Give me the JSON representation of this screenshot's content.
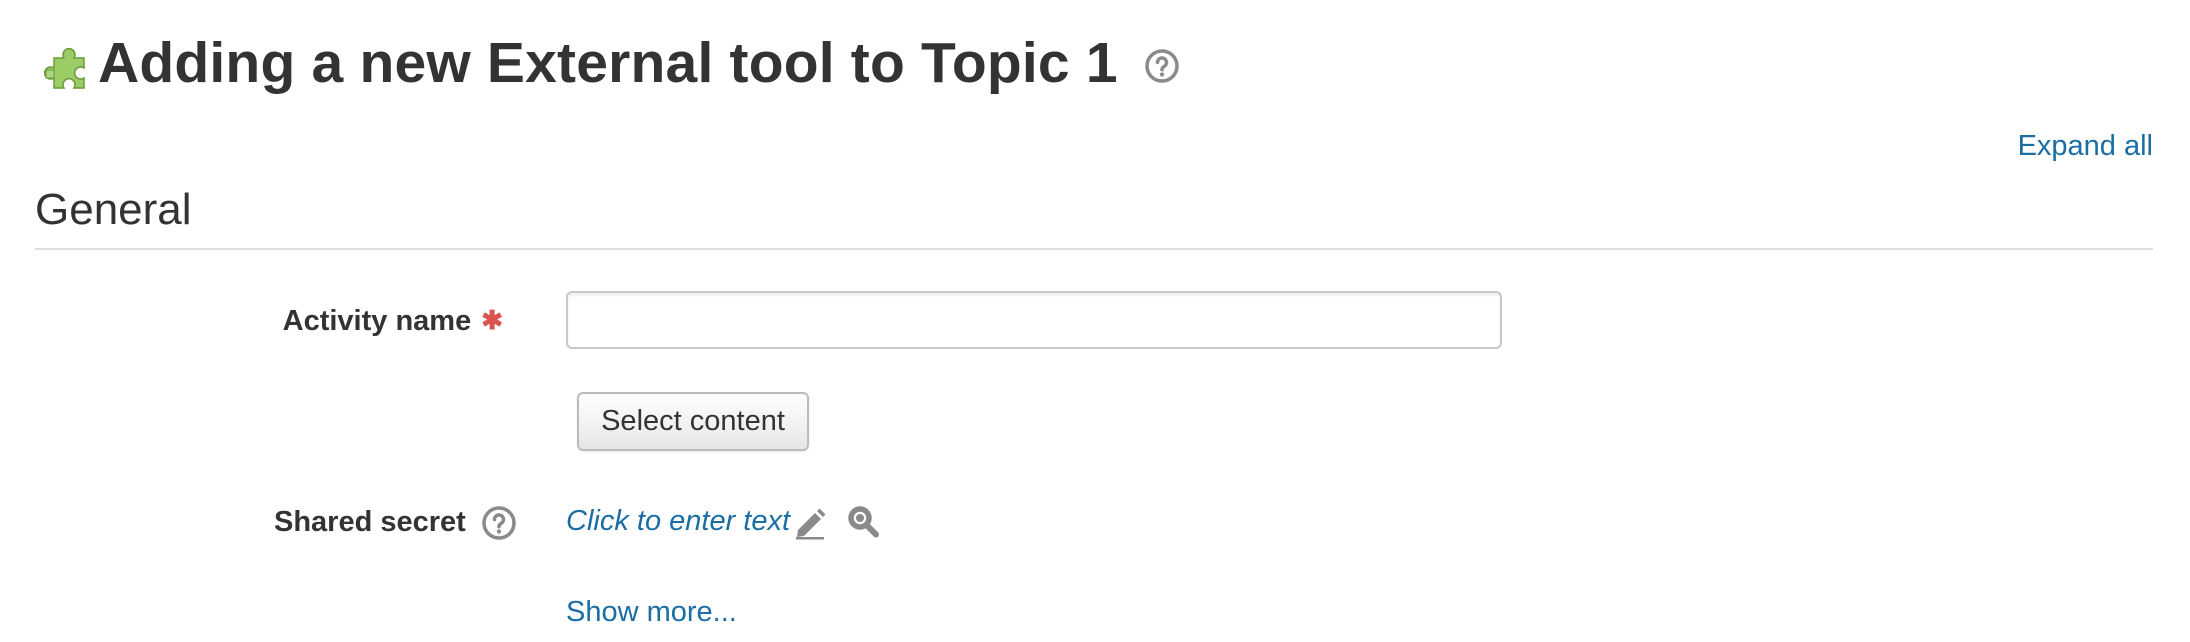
{
  "header": {
    "icon": "puzzle-piece-icon",
    "title": "Adding a new External tool to Topic 1",
    "help_icon": "question-circle-icon"
  },
  "toolbar": {
    "expand_all_label": "Expand all"
  },
  "section": {
    "legend": "General"
  },
  "form": {
    "activity_name": {
      "label": "Activity name",
      "required": true,
      "value": "",
      "placeholder": ""
    },
    "select_content_label": "Select content",
    "shared_secret": {
      "label": "Shared secret",
      "help_icon": "question-circle-icon",
      "edit_text": "Click to enter text",
      "edit_icon": "pencil-icon",
      "reveal_icon": "magnifier-icon"
    },
    "show_more_label": "Show more..."
  },
  "colors": {
    "link": "#1a6ea4",
    "text": "#333333",
    "required": "#d9534f",
    "icon_gray": "#8a8a8a",
    "puzzle_green": "#8bc34a"
  }
}
